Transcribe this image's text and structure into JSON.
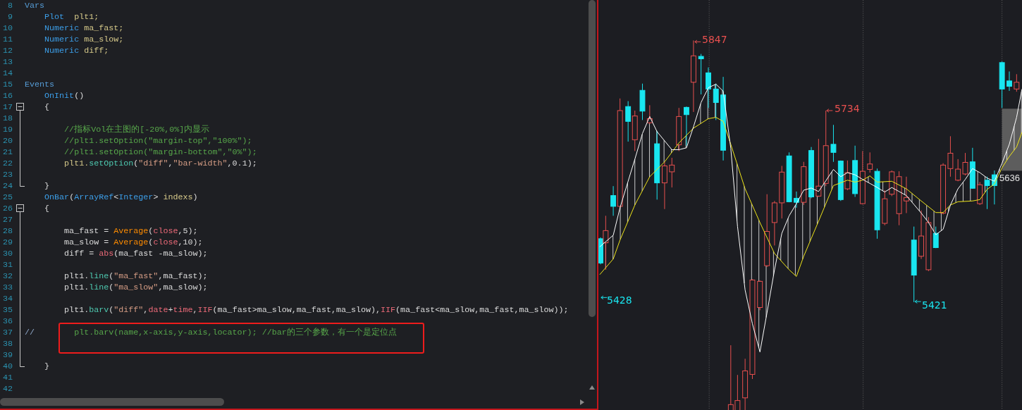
{
  "editor": {
    "lines": [
      {
        "number": "8",
        "kind": "plain",
        "tokens": [
          {
            "kind": "kw",
            "text": "Vars"
          }
        ]
      },
      {
        "number": "9",
        "kind": "plain",
        "tokens": [
          {
            "kind": "type",
            "text": "    Plot"
          },
          {
            "kind": "ident",
            "text": "  plt1;"
          }
        ]
      },
      {
        "number": "10",
        "kind": "plain",
        "tokens": [
          {
            "kind": "type",
            "text": "    Numeric"
          },
          {
            "kind": "ident",
            "text": " ma_fast;"
          }
        ]
      },
      {
        "number": "11",
        "kind": "plain",
        "tokens": [
          {
            "kind": "type",
            "text": "    Numeric"
          },
          {
            "kind": "ident",
            "text": " ma_slow;"
          }
        ]
      },
      {
        "number": "12",
        "kind": "plain",
        "tokens": [
          {
            "kind": "type",
            "text": "    Numeric"
          },
          {
            "kind": "ident",
            "text": " diff;"
          }
        ]
      },
      {
        "number": "13",
        "kind": "plain"
      },
      {
        "number": "14",
        "kind": "plain"
      },
      {
        "number": "15",
        "kind": "plain",
        "tokens": [
          {
            "kind": "kw",
            "text": "Events"
          }
        ]
      },
      {
        "number": "16",
        "kind": "plain",
        "tokens": [
          {
            "kind": "type",
            "text": "    OnInit"
          },
          {
            "kind": "plain",
            "text": "()"
          }
        ]
      },
      {
        "number": "17",
        "kind": "fold-open",
        "tokens": [
          {
            "kind": "plain",
            "text": "    {"
          }
        ]
      },
      {
        "number": "18",
        "kind": "fold-guide"
      },
      {
        "number": "19",
        "kind": "fold-guide",
        "tokens": [
          {
            "kind": "comment",
            "text": "        //指标Vol在主图的[-20%,0%]内显示"
          }
        ]
      },
      {
        "number": "20",
        "kind": "fold-guide",
        "tokens": [
          {
            "kind": "comment",
            "text": "        //plt1.setOption(\"margin-top\",\"100%\");"
          }
        ]
      },
      {
        "number": "21",
        "kind": "fold-guide",
        "tokens": [
          {
            "kind": "comment",
            "text": "        //plt1.setOption(\"margin-bottom\",\"0%\");"
          }
        ]
      },
      {
        "number": "22",
        "kind": "fold-guide",
        "tokens": [
          {
            "kind": "ident",
            "text": "        plt1."
          },
          {
            "kind": "method",
            "text": "setOption"
          },
          {
            "kind": "plain",
            "text": "("
          },
          {
            "kind": "string",
            "text": "\"diff\""
          },
          {
            "kind": "plain",
            "text": ","
          },
          {
            "kind": "string",
            "text": "\"bar-width\""
          },
          {
            "kind": "plain",
            "text": ",0.1);"
          }
        ]
      },
      {
        "number": "23",
        "kind": "fold-guide"
      },
      {
        "number": "24",
        "kind": "fold-end",
        "tokens": [
          {
            "kind": "plain",
            "text": "    }"
          }
        ]
      },
      {
        "number": "25",
        "kind": "plain",
        "tokens": [
          {
            "kind": "type",
            "text": "    OnBar"
          },
          {
            "kind": "plain",
            "text": "("
          },
          {
            "kind": "type",
            "text": "ArrayRef"
          },
          {
            "kind": "plain",
            "text": "<"
          },
          {
            "kind": "type",
            "text": "Integer"
          },
          {
            "kind": "plain",
            "text": "> "
          },
          {
            "kind": "ident",
            "text": "indexs"
          },
          {
            "kind": "plain",
            "text": ")"
          }
        ]
      },
      {
        "number": "26",
        "kind": "fold-open",
        "tokens": [
          {
            "kind": "plain",
            "text": "    {"
          }
        ]
      },
      {
        "number": "27",
        "kind": "fold-guide"
      },
      {
        "number": "28",
        "kind": "fold-guide",
        "tokens": [
          {
            "kind": "plain",
            "text": "        ma_fast = "
          },
          {
            "kind": "func",
            "text": "Average"
          },
          {
            "kind": "plain",
            "text": "("
          },
          {
            "kind": "builtin",
            "text": "close"
          },
          {
            "kind": "plain",
            "text": ",5);"
          }
        ]
      },
      {
        "number": "29",
        "kind": "fold-guide",
        "tokens": [
          {
            "kind": "plain",
            "text": "        ma_slow = "
          },
          {
            "kind": "func",
            "text": "Average"
          },
          {
            "kind": "plain",
            "text": "("
          },
          {
            "kind": "builtin",
            "text": "close"
          },
          {
            "kind": "plain",
            "text": ",10);"
          }
        ]
      },
      {
        "number": "30",
        "kind": "fold-guide",
        "tokens": [
          {
            "kind": "plain",
            "text": "        diff = "
          },
          {
            "kind": "builtin",
            "text": "abs"
          },
          {
            "kind": "plain",
            "text": "(ma_fast -ma_slow);"
          }
        ]
      },
      {
        "number": "31",
        "kind": "fold-guide"
      },
      {
        "number": "32",
        "kind": "fold-guide",
        "tokens": [
          {
            "kind": "plain",
            "text": "        plt1."
          },
          {
            "kind": "method",
            "text": "line"
          },
          {
            "kind": "plain",
            "text": "("
          },
          {
            "kind": "string",
            "text": "\"ma_fast\""
          },
          {
            "kind": "plain",
            "text": ",ma_fast);"
          }
        ]
      },
      {
        "number": "33",
        "kind": "fold-guide",
        "tokens": [
          {
            "kind": "plain",
            "text": "        plt1."
          },
          {
            "kind": "method",
            "text": "line"
          },
          {
            "kind": "plain",
            "text": "("
          },
          {
            "kind": "string",
            "text": "\"ma_slow\""
          },
          {
            "kind": "plain",
            "text": ",ma_slow);"
          }
        ]
      },
      {
        "number": "34",
        "kind": "fold-guide"
      },
      {
        "number": "35",
        "kind": "fold-guide",
        "tokens": [
          {
            "kind": "plain",
            "text": "        plt1."
          },
          {
            "kind": "method",
            "text": "barv"
          },
          {
            "kind": "plain",
            "text": "("
          },
          {
            "kind": "string",
            "text": "\"diff\""
          },
          {
            "kind": "plain",
            "text": ","
          },
          {
            "kind": "builtin",
            "text": "date"
          },
          {
            "kind": "plain",
            "text": "+"
          },
          {
            "kind": "builtin",
            "text": "time"
          },
          {
            "kind": "plain",
            "text": ","
          },
          {
            "kind": "builtin",
            "text": "IIF"
          },
          {
            "kind": "plain",
            "text": "(ma_fast>ma_slow,ma_fast,ma_slow),"
          },
          {
            "kind": "builtin",
            "text": "IIF"
          },
          {
            "kind": "plain",
            "text": "(ma_fast<ma_slow,ma_fast,ma_slow));"
          }
        ]
      },
      {
        "number": "36",
        "kind": "fold-guide"
      },
      {
        "number": "37",
        "kind": "fold-guide",
        "boxed": true,
        "tokens": [
          {
            "kind": "marker",
            "text": "//"
          },
          {
            "kind": "comment",
            "text": "        plt.barv(name,x-axis,y-axis,locator); //bar的三个参数，有一个是定位点"
          }
        ]
      },
      {
        "number": "38",
        "kind": "fold-guide",
        "boxed": true
      },
      {
        "number": "39",
        "kind": "fold-guide"
      },
      {
        "number": "40",
        "kind": "fold-end",
        "tokens": [
          {
            "kind": "plain",
            "text": "    }"
          }
        ]
      },
      {
        "number": "41",
        "kind": "plain"
      },
      {
        "number": "42",
        "kind": "plain"
      }
    ]
  },
  "chart": {
    "labels": [
      {
        "text": "5847",
        "color": "#e8504f"
      },
      {
        "text": "5734",
        "color": "#e8504f"
      },
      {
        "text": "5428",
        "color": "#19e6f0"
      },
      {
        "text": "5421",
        "color": "#19e6f0"
      },
      {
        "text": "5636",
        "color": "#e6e6e6"
      }
    ]
  }
}
